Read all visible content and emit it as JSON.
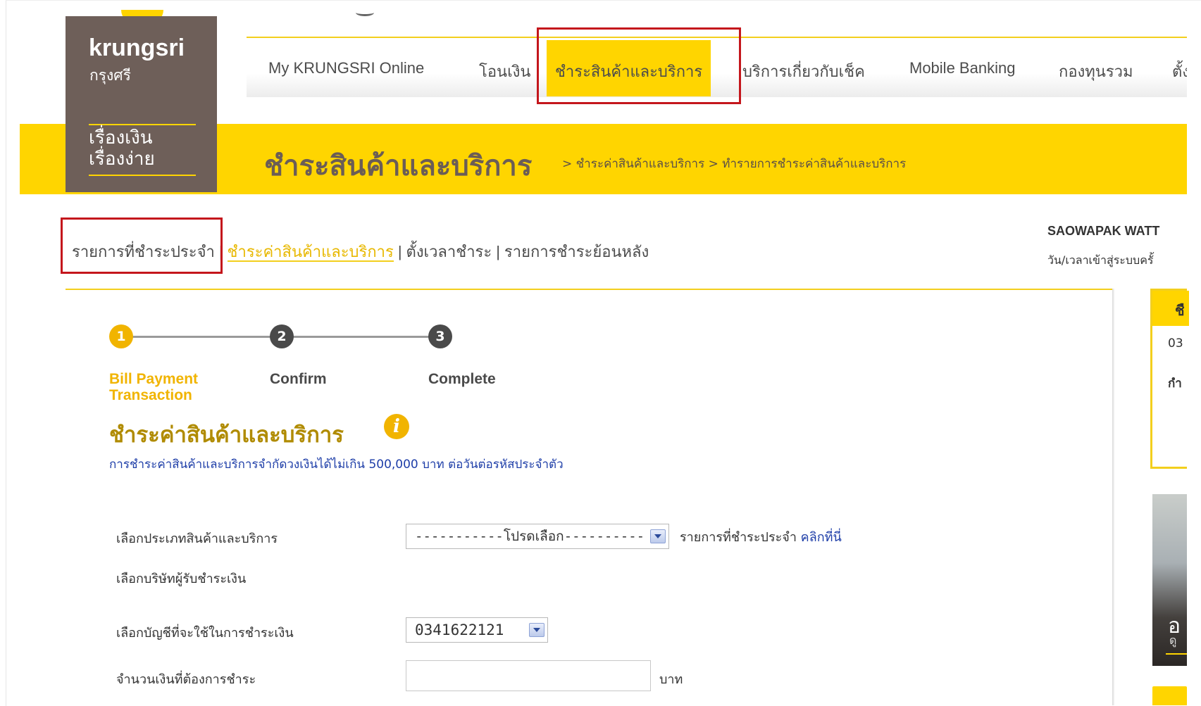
{
  "logo": {
    "name": "krungsri",
    "thai_name": "กรุงศรี",
    "tagline_line1": "เรื่องเงิน",
    "tagline_line2": "เรื่องง่าย"
  },
  "nav": {
    "items": [
      {
        "label": "My KRUNGSRI Online"
      },
      {
        "label": "โอนเงิน"
      },
      {
        "label": "ชำระสินค้าและบริการ",
        "active": true
      },
      {
        "label": "บริการเกี่ยวกับเช็ค"
      },
      {
        "label": "Mobile Banking"
      },
      {
        "label": "กองทุนรวม"
      },
      {
        "label": "ตั้ง"
      }
    ]
  },
  "banner": {
    "title": "ชำระสินค้าและบริการ",
    "breadcrumb": "> ชำระค่าสินค้าและบริการ > ทำรายการชำระค่าสินค้าและบริการ"
  },
  "subnav": {
    "items": [
      {
        "label": "รายการที่ชำระประจำ"
      },
      {
        "label": "ชำระค่าสินค้าและบริการ",
        "active": true
      },
      {
        "label": "ตั้งเวลาชำระ"
      },
      {
        "label": "รายการชำระย้อนหลัง"
      }
    ],
    "separator": "|"
  },
  "user": {
    "name": "SAOWAPAK WATT",
    "login_time_label": "วัน/เวลาเข้าสู่ระบบครั้"
  },
  "steps": [
    {
      "number": "1",
      "label": "Bill Payment Transaction",
      "current": true
    },
    {
      "number": "2",
      "label": "Confirm"
    },
    {
      "number": "3",
      "label": "Complete"
    }
  ],
  "section": {
    "title": "ชำระค่าสินค้าและบริการ",
    "info_icon": "info-icon",
    "limit_text": "การชำระค่าสินค้าและบริการจำกัดวงเงินได้ไม่เกิน 500,000 บาท ต่อวันต่อรหัสประจำตัว"
  },
  "form": {
    "product_type_label": "เลือกประเภทสินค้าและบริการ",
    "product_type_value": "-----------โปรดเลือก----------",
    "regular_note": "รายการที่ชำระประจำ",
    "regular_link": "คลิกที่นี่",
    "company_label": "เลือกบริษัทผู้รับชำระเงิน",
    "account_label": "เลือกบัญชีที่จะใช้ในการชำระเงิน",
    "account_value": "0341622121",
    "amount_label": "จำนวนเงินที่ต้องการชำระ",
    "amount_value": "",
    "amount_unit": "บาท"
  },
  "side_panel": {
    "card_head": "ชื",
    "account_partial": "03",
    "balance_partial": "กำ",
    "promo_text1": "อ",
    "promo_text2": "ดู"
  },
  "colors": {
    "brand_yellow": "#ffd500",
    "brand_brown": "#6e5f59",
    "highlight_red": "#c4161c",
    "step_active": "#f1b400",
    "link_blue": "#1e3ea8"
  }
}
